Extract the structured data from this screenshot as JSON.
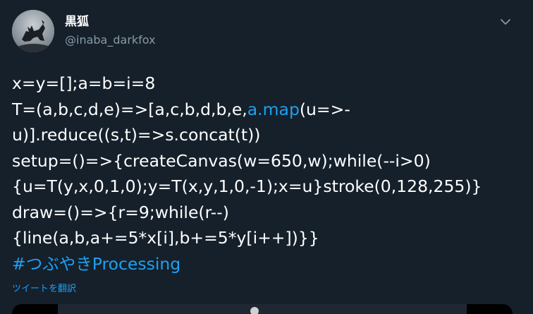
{
  "user": {
    "display_name": "黒狐",
    "handle": "@inaba_darkfox"
  },
  "tweet": {
    "lines": [
      {
        "before": "x=y=[];a=b=i=8",
        "link": "",
        "after": ""
      },
      {
        "before": "T=(a,b,c,d,e)=>[a,c,b,d,b,e,",
        "link": "a.map",
        "after": "(u=>-"
      },
      {
        "before": "u)].reduce((s,t)=>s.concat(t))",
        "link": "",
        "after": ""
      },
      {
        "before": "setup=()=>{createCanvas(w=650,w);while(--i>0)",
        "link": "",
        "after": ""
      },
      {
        "before": "{u=T(y,x,0,1,0);y=T(x,y,1,0,-1);x=u}stroke(0,128,255)}",
        "link": "",
        "after": ""
      },
      {
        "before": "draw=()=>{r=9;while(r--)",
        "link": "",
        "after": ""
      },
      {
        "before": "{line(a,b,a+=5*x[i],b+=5*y[i++])}}",
        "link": "",
        "after": ""
      },
      {
        "before": "",
        "link": "#つぶやきProcessing",
        "after": ""
      }
    ],
    "translate_label": "ツイートを翻訳"
  },
  "icons": {
    "caret": "chevron-down-icon",
    "avatar": "fox-silhouette-avatar"
  },
  "colors": {
    "background": "#15202b",
    "link": "#1da1f2",
    "secondary_text": "#8899a6"
  }
}
